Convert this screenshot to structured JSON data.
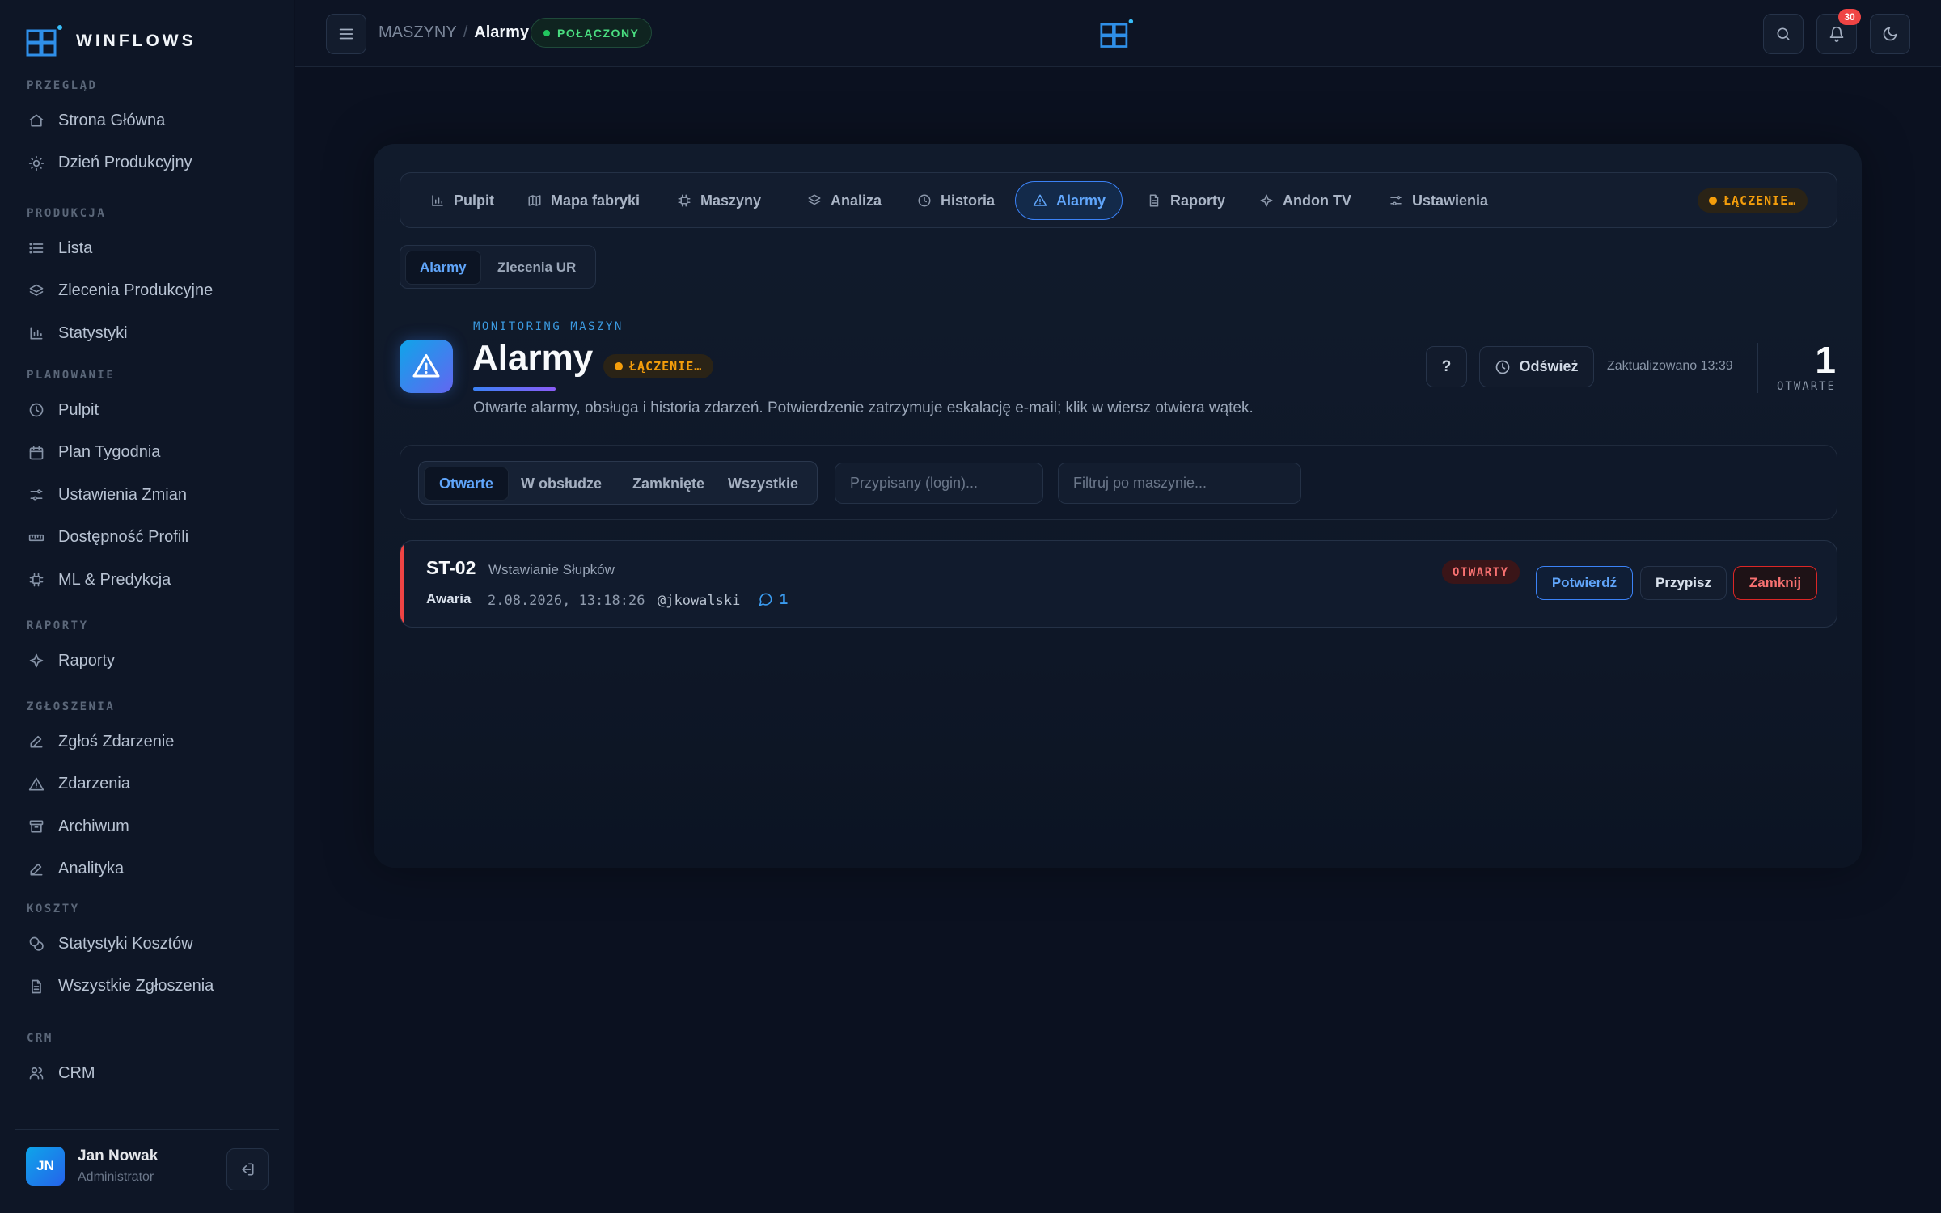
{
  "app": {
    "brand": "WINFLOWS"
  },
  "sidebar": {
    "sections": [
      {
        "title": "PRZEGLĄD",
        "items": [
          {
            "label": "Strona Główna",
            "icon": "home-icon"
          },
          {
            "label": "Dzień Produkcyjny",
            "icon": "sun-icon"
          }
        ]
      },
      {
        "title": "PRODUKCJA",
        "items": [
          {
            "label": "Lista",
            "icon": "list-icon"
          },
          {
            "label": "Zlecenia Produkcyjne",
            "icon": "layers-icon"
          },
          {
            "label": "Statystyki",
            "icon": "bar-chart-icon"
          }
        ]
      },
      {
        "title": "PLANOWANIE",
        "items": [
          {
            "label": "Pulpit",
            "icon": "clock-icon"
          },
          {
            "label": "Plan Tygodnia",
            "icon": "calendar-icon"
          },
          {
            "label": "Ustawienia Zmian",
            "icon": "sliders-icon"
          },
          {
            "label": "Dostępność Profili",
            "icon": "ruler-icon"
          },
          {
            "label": "ML & Predykcja",
            "icon": "cpu-icon"
          }
        ]
      },
      {
        "title": "RAPORTY",
        "items": [
          {
            "label": "Raporty",
            "icon": "sparkle-icon"
          }
        ]
      },
      {
        "title": "ZGŁOSZENIA",
        "items": [
          {
            "label": "Zgłoś Zdarzenie",
            "icon": "pen-icon"
          },
          {
            "label": "Zdarzenia",
            "icon": "warning-icon"
          },
          {
            "label": "Archiwum",
            "icon": "archive-icon"
          },
          {
            "label": "Analityka",
            "icon": "pen-icon"
          }
        ]
      },
      {
        "title": "KOSZTY",
        "items": [
          {
            "label": "Statystyki Kosztów",
            "icon": "coins-icon"
          },
          {
            "label": "Wszystkie Zgłoszenia",
            "icon": "file-icon"
          }
        ]
      },
      {
        "title": "CRM",
        "items": [
          {
            "label": "CRM",
            "icon": "users-icon"
          }
        ]
      }
    ],
    "user": {
      "initials": "JN",
      "name": "Jan Nowak",
      "role": "Administrator"
    }
  },
  "topbar": {
    "breadcrumb_parent": "MASZYNY",
    "breadcrumb_sep": "/",
    "breadcrumb_current": "Alarmy",
    "connection": "POŁĄCZONY",
    "notifications_count": "30"
  },
  "tabs": [
    {
      "label": "Pulpit",
      "icon": "bar-chart-icon",
      "active": false
    },
    {
      "label": "Mapa fabryki",
      "icon": "map-icon",
      "active": false
    },
    {
      "label": "Maszyny",
      "icon": "cpu-icon",
      "active": false
    },
    {
      "label": "Analiza",
      "icon": "layers-icon",
      "active": false
    },
    {
      "label": "Historia",
      "icon": "clock-icon",
      "active": false
    },
    {
      "label": "Alarmy",
      "icon": "warning-icon",
      "active": true
    },
    {
      "label": "Raporty",
      "icon": "file-icon",
      "active": false
    },
    {
      "label": "Andon TV",
      "icon": "sparkle-icon",
      "active": false
    },
    {
      "label": "Ustawienia",
      "icon": "sliders-icon",
      "active": false
    }
  ],
  "tab_status": "ŁĄCZENIE…",
  "subtabs": {
    "alarms": "Alarmy",
    "work_orders": "Zlecenia UR"
  },
  "header": {
    "eyebrow": "MONITORING MASZYN",
    "title": "Alarmy",
    "status": "ŁĄCZENIE…",
    "subtitle": "Otwarte alarmy, obsługa i historia zdarzeń. Potwierdzenie zatrzymuje eskalację e-mail; klik w wiersz otwiera wątek.",
    "help": "?",
    "refresh": "Odśwież",
    "updated": "Zaktualizowano 13:39",
    "open_count": "1",
    "open_label": "OTWARTE"
  },
  "filters": {
    "segments": [
      "Otwarte",
      "W obsłudze",
      "Zamknięte",
      "Wszystkie"
    ],
    "active_segment": "Otwarte",
    "assignee_placeholder": "Przypisany (login)...",
    "machine_placeholder": "Filtruj po maszynie..."
  },
  "alarms": [
    {
      "machine_id": "ST-02",
      "machine_name": "Wstawianie Słupków",
      "type": "Awaria",
      "time": "2.08.2026, 13:18:26",
      "user": "@jkowalski",
      "comments": "1",
      "status": "OTWARTY",
      "actions": {
        "confirm": "Potwierdź",
        "assign": "Przypisz",
        "close": "Zamknij"
      }
    }
  ],
  "colors": {
    "accent": "#3b82f6",
    "danger": "#ef4444",
    "warning": "#f59e0b",
    "success": "#22c55e"
  }
}
